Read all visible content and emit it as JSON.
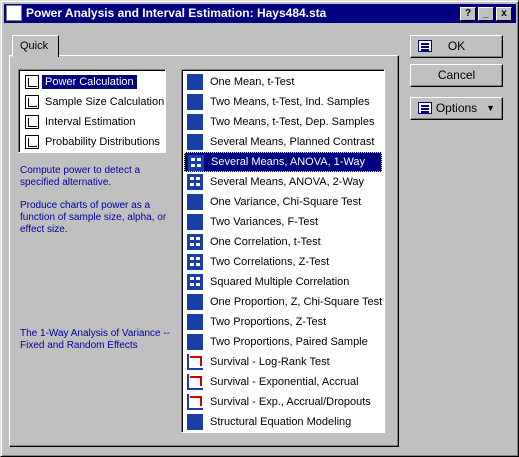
{
  "window": {
    "title": "Power Analysis and Interval Estimation: Hays484.sta",
    "help_label": "?",
    "minimize_label": "_",
    "close_label": "x"
  },
  "tab": {
    "label": "Quick"
  },
  "modes": [
    {
      "label": "Power Calculation",
      "selected": true
    },
    {
      "label": "Sample Size Calculation",
      "selected": false
    },
    {
      "label": "Interval Estimation",
      "selected": false
    },
    {
      "label": "Probability Distributions",
      "selected": false
    }
  ],
  "descriptions": {
    "line1": "Compute power to detect a specified alternative.",
    "line2": "Produce charts of power as a function of sample size, alpha, or effect size.",
    "line3": "The 1-Way Analysis of Variance -- Fixed and Random Effects"
  },
  "analyses": [
    {
      "label": "One Mean, t-Test",
      "icon": "bar-icon"
    },
    {
      "label": "Two Means, t-Test, Ind. Samples",
      "icon": "bar-icon"
    },
    {
      "label": "Two Means, t-Test, Dep. Samples",
      "icon": "bar-icon"
    },
    {
      "label": "Several Means, Planned Contrast",
      "icon": "bar-icon"
    },
    {
      "label": "Several Means, ANOVA, 1-Way",
      "icon": "grid-icon",
      "selected": true
    },
    {
      "label": "Several Means, ANOVA, 2-Way",
      "icon": "grid-icon"
    },
    {
      "label": "One Variance, Chi-Square Test",
      "icon": "bar-icon"
    },
    {
      "label": "Two Variances, F-Test",
      "icon": "bar-icon"
    },
    {
      "label": "One Correlation, t-Test",
      "icon": "grid-icon"
    },
    {
      "label": "Two Correlations, Z-Test",
      "icon": "grid-icon"
    },
    {
      "label": "Squared Multiple Correlation",
      "icon": "grid-icon"
    },
    {
      "label": "One Proportion, Z, Chi-Square Test",
      "icon": "bar-icon"
    },
    {
      "label": "Two Proportions, Z-Test",
      "icon": "bar-icon"
    },
    {
      "label": "Two Proportions, Paired Sample",
      "icon": "bar-icon"
    },
    {
      "label": "Survival - Log-Rank Test",
      "icon": "survival-icon"
    },
    {
      "label": "Survival - Exponential, Accrual",
      "icon": "survival-icon"
    },
    {
      "label": "Survival - Exp., Accrual/Dropouts",
      "icon": "survival-icon"
    },
    {
      "label": "Structural Equation Modeling",
      "icon": "network-icon"
    }
  ],
  "buttons": {
    "ok": "OK",
    "cancel": "Cancel",
    "options": "Options"
  },
  "colors": {
    "titlebar": "#000080",
    "selection": "#000080",
    "description_text": "#0000a0"
  }
}
